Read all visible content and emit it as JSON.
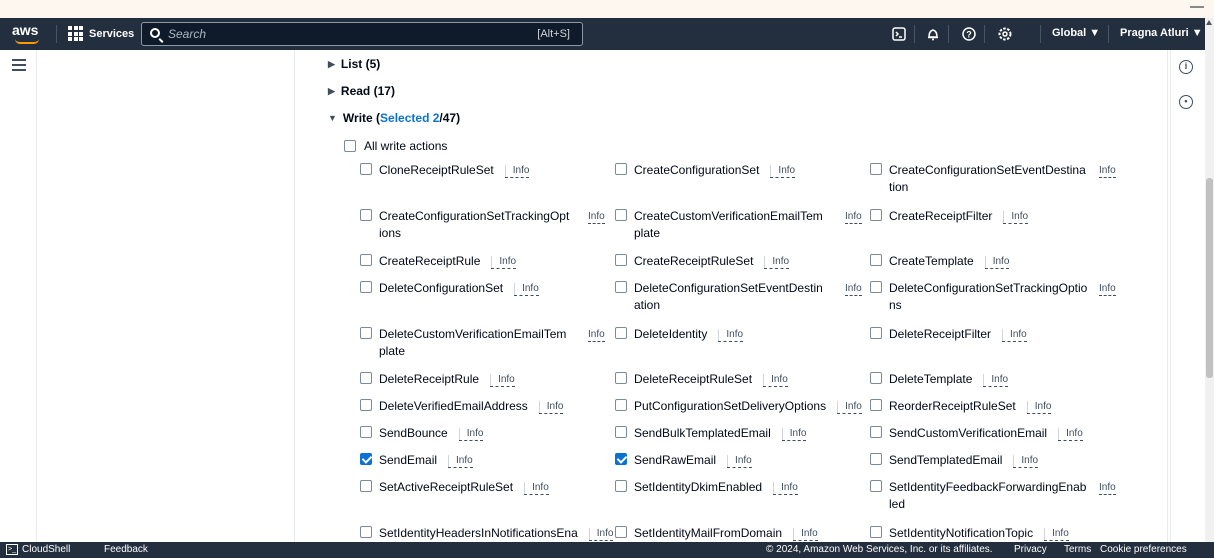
{
  "navbar": {
    "logo": "aws",
    "services_label": "Services",
    "search_placeholder": "Search",
    "search_shortcut": "[Alt+S]",
    "region": "Global ▼",
    "user": "Pragna Atluri ▼"
  },
  "sections": {
    "list": {
      "label": "List (5)"
    },
    "read": {
      "label": "Read (17)"
    },
    "write": {
      "prefix": "Write (",
      "selected": "Selected 2",
      "suffix": "/47)"
    }
  },
  "all_write_label": "All write actions",
  "info_label": "Info",
  "actions": [
    {
      "name": "CloneReceiptRuleSet",
      "checked": false
    },
    {
      "name": "CreateConfigurationSet",
      "checked": false
    },
    {
      "name": "CreateConfigurationSetEventDestination",
      "checked": false
    },
    {
      "name": "CreateConfigurationSetTrackingOptions",
      "checked": false
    },
    {
      "name": "CreateCustomVerificationEmailTemplate",
      "checked": false
    },
    {
      "name": "CreateReceiptFilter",
      "checked": false
    },
    {
      "name": "CreateReceiptRule",
      "checked": false
    },
    {
      "name": "CreateReceiptRuleSet",
      "checked": false
    },
    {
      "name": "CreateTemplate",
      "checked": false
    },
    {
      "name": "DeleteConfigurationSet",
      "checked": false
    },
    {
      "name": "DeleteConfigurationSetEventDestination",
      "checked": false
    },
    {
      "name": "DeleteConfigurationSetTrackingOptions",
      "checked": false
    },
    {
      "name": "DeleteCustomVerificationEmailTemplate",
      "checked": false
    },
    {
      "name": "DeleteIdentity",
      "checked": false
    },
    {
      "name": "DeleteReceiptFilter",
      "checked": false
    },
    {
      "name": "DeleteReceiptRule",
      "checked": false
    },
    {
      "name": "DeleteReceiptRuleSet",
      "checked": false
    },
    {
      "name": "DeleteTemplate",
      "checked": false
    },
    {
      "name": "DeleteVerifiedEmailAddress",
      "checked": false
    },
    {
      "name": "PutConfigurationSetDeliveryOptions",
      "checked": false
    },
    {
      "name": "ReorderReceiptRuleSet",
      "checked": false
    },
    {
      "name": "SendBounce",
      "checked": false
    },
    {
      "name": "SendBulkTemplatedEmail",
      "checked": false
    },
    {
      "name": "SendCustomVerificationEmail",
      "checked": false
    },
    {
      "name": "SendEmail",
      "checked": true
    },
    {
      "name": "SendRawEmail",
      "checked": true
    },
    {
      "name": "SendTemplatedEmail",
      "checked": false
    },
    {
      "name": "SetActiveReceiptRuleSet",
      "checked": false
    },
    {
      "name": "SetIdentityDkimEnabled",
      "checked": false
    },
    {
      "name": "SetIdentityFeedbackForwardingEnabled",
      "checked": false
    },
    {
      "name": "SetIdentityHeadersInNotificationsEna",
      "checked": false
    },
    {
      "name": "SetIdentityMailFromDomain",
      "checked": false
    },
    {
      "name": "SetIdentityNotificationTopic",
      "checked": false
    }
  ],
  "footer": {
    "cloudshell": "CloudShell",
    "feedback": "Feedback",
    "copyright": "© 2024, Amazon Web Services, Inc. or its affiliates.",
    "privacy": "Privacy",
    "terms": "Terms",
    "cookie": "Cookie preferences"
  },
  "colors": {
    "nav_bg": "#232f3e",
    "accent": "#0972d3",
    "aws_orange": "#ff9900"
  }
}
